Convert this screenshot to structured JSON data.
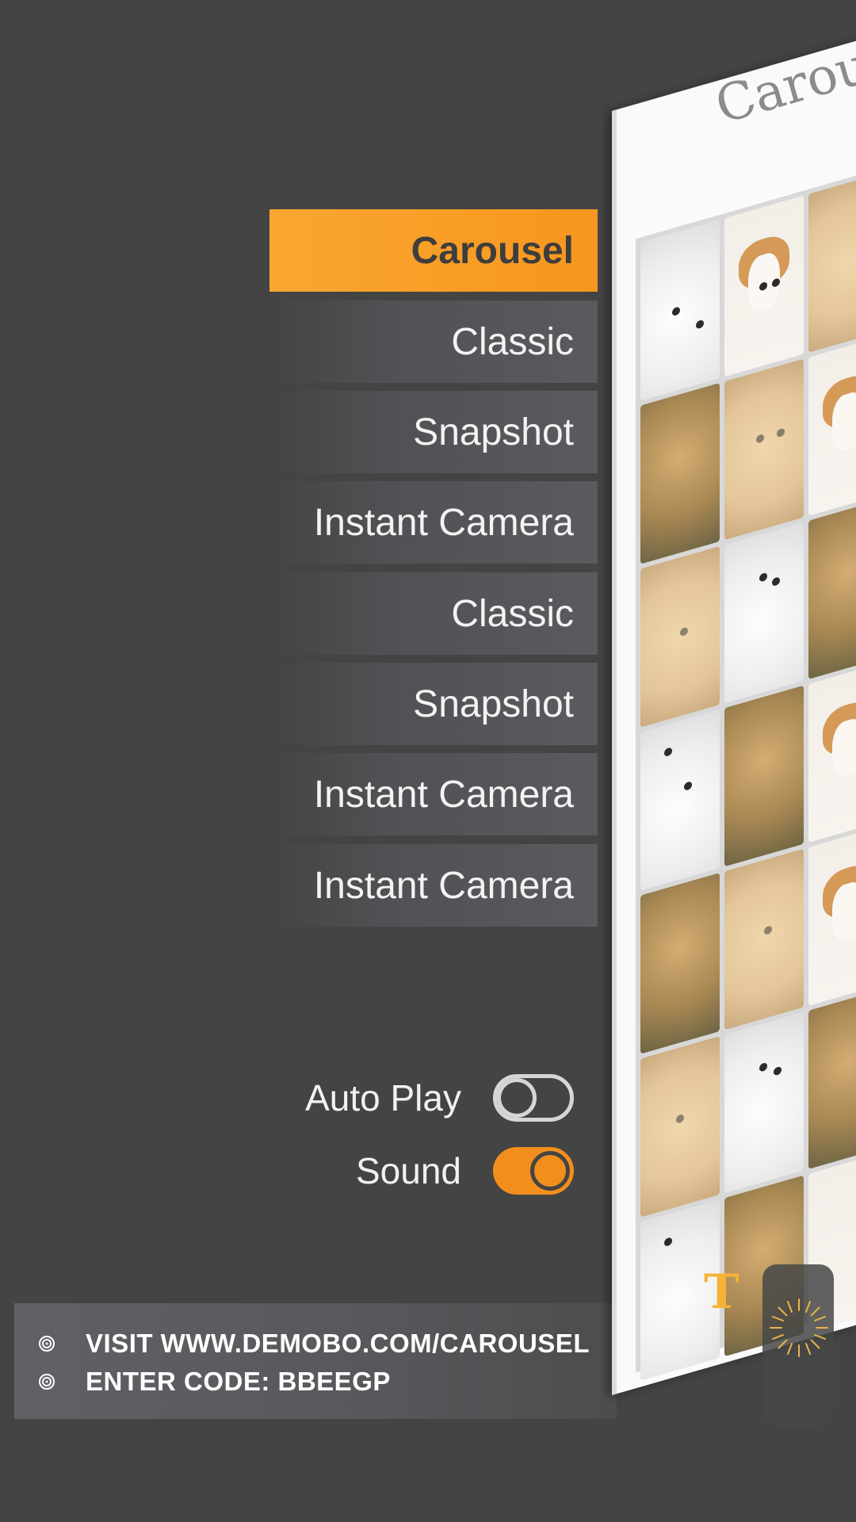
{
  "menu": {
    "items": [
      {
        "label": "Carousel",
        "active": true
      },
      {
        "label": "Classic",
        "active": false
      },
      {
        "label": "Snapshot",
        "active": false
      },
      {
        "label": "Instant Camera",
        "active": false
      },
      {
        "label": "Classic",
        "active": false
      },
      {
        "label": "Snapshot",
        "active": false
      },
      {
        "label": "Instant Camera",
        "active": false
      },
      {
        "label": "Instant Camera",
        "active": false
      }
    ]
  },
  "settings": {
    "autoplay": {
      "label": "Auto Play",
      "enabled": false
    },
    "sound": {
      "label": "Sound",
      "enabled": true
    }
  },
  "footer": {
    "line1": "VISIT WWW.DEMOBO.COM/CAROUSEL",
    "line2": "ENTER CODE: BBEEGP",
    "icon": "demobo-logo-icon"
  },
  "preview": {
    "title": "Carouse",
    "overlay_letter": "T",
    "badge_icon": "sunburst-icon"
  },
  "colors": {
    "background": "#444444",
    "accent": "#f6961e",
    "menu_item": "#5a5b5f"
  }
}
